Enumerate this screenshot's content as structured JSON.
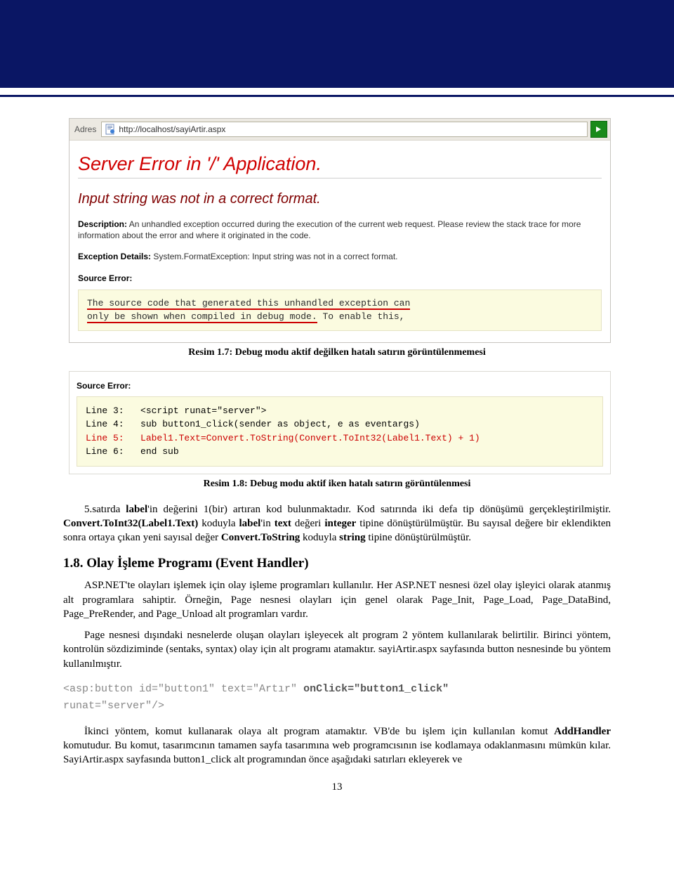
{
  "shot1": {
    "addr_label": "Adres",
    "url": "http://localhost/sayiArtir.aspx",
    "title": "Server Error in '/' Application.",
    "subtitle": "Input string was not in a correct format.",
    "desc_label": "Description:",
    "desc_text": "An unhandled exception occurred during the execution of the current web request. Please review the stack trace for more information about the error and where it originated in the code.",
    "exc_label": "Exception Details:",
    "exc_text": "System.FormatException: Input string was not in a correct format.",
    "src_label": "Source Error:",
    "code_l1": "The source code that generated this unhandled exception can",
    "code_l2a": "only be shown when compiled in debug mode.",
    "code_l2b": " To enable this,"
  },
  "caption1": "Resim 1.7: Debug modu aktif değilken hatalı satırın görüntülenmemesi",
  "shot2": {
    "src_label": "Source Error:",
    "l3": "Line 3:   <script runat=\"server\">",
    "l4": "Line 4:   sub button1_click(sender as object, e as eventargs)",
    "l5": "Line 5:   Label1.Text=Convert.ToString(Convert.ToInt32(Label1.Text) + 1)",
    "l6": "Line 6:   end sub"
  },
  "caption2": "Resim 1.8: Debug modu aktif iken hatalı satırın görüntülenmesi",
  "para1_a": "5.satırda ",
  "para1_b": "'in değerini 1(bir) artıran kod bulunmaktadır. Kod satırında iki defa tip dönüşümü gerçekleştirilmiştir. ",
  "para1_c": " koduyla ",
  "para1_d": "'in ",
  "para1_e": " değeri ",
  "para1_f": " tipine dönüştürülmüştür. Bu sayısal değere bir eklendikten sonra ortaya çıkan yeni sayısal değer ",
  "para1_g": " koduyla ",
  "para1_h": " tipine dönüştürülmüştür.",
  "bold": {
    "label": "label",
    "convert1": "Convert.ToInt32(Label1.Text)",
    "text": "text",
    "integer": "integer",
    "convert2": "Convert.ToString",
    "string": "string",
    "addh": "AddHandler"
  },
  "heading": "1.8. Olay İşleme Programı (Event Handler)",
  "para2": "ASP.NET'te olayları işlemek için olay işleme programları kullanılır. Her ASP.NET nesnesi özel olay işleyici olarak atanmış alt programlara sahiptir. Örneğin, Page nesnesi olayları için genel olarak Page_Init, Page_Load, Page_DataBind, Page_PreRender, and Page_Unload alt programları vardır.",
  "para3": "Page nesnesi dışındaki nesnelerde oluşan olayları işleyecek alt program 2 yöntem kullanılarak belirtilir. Birinci yöntem, kontrolün sözdiziminde (sentaks, syntax) olay için alt programı atamaktır. sayiArtir.aspx sayfasında button nesnesinde bu yöntem kullanılmıştır.",
  "code_snip": {
    "part1": "<asp:button id=\"button1\" text=\"Artır\" ",
    "part2": "onClick=\"button1_click\"",
    "part3": "\nrunat=\"server\"/>"
  },
  "para4_a": "İkinci yöntem, komut kullanarak olaya alt program atamaktır. VB'de bu işlem için kullanılan komut ",
  "para4_b": " komutudur. Bu komut, tasarımcının tamamen sayfa tasarımına web programcısının ise kodlamaya odaklanmasını mümkün kılar. SayiArtir.aspx sayfasında button1_click alt programından önce aşağıdaki satırları ekleyerek ve",
  "page_num": "13"
}
